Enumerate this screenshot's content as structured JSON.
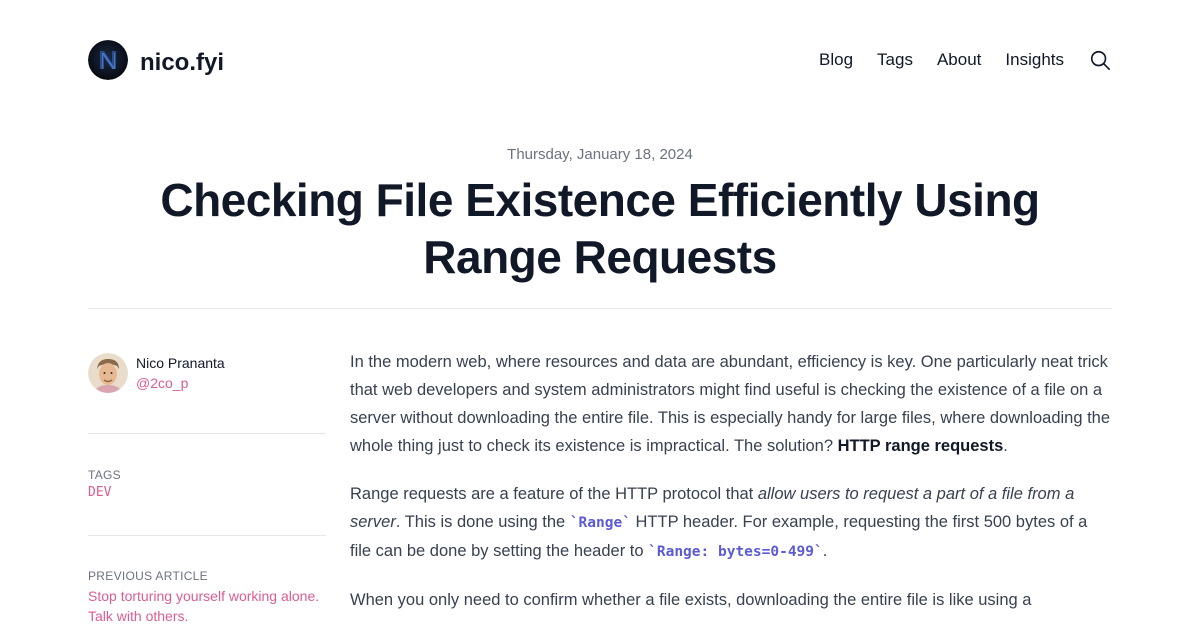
{
  "site": {
    "name": "nico.fyi"
  },
  "nav": {
    "items": [
      {
        "label": "Blog"
      },
      {
        "label": "Tags"
      },
      {
        "label": "About"
      },
      {
        "label": "Insights"
      }
    ]
  },
  "post": {
    "date": "Thursday, January 18, 2024",
    "title": "Checking File Existence Efficiently Using Range Requests"
  },
  "author": {
    "name": "Nico Prananta",
    "handle": "@2co_p"
  },
  "tags": {
    "label": "TAGS",
    "items": [
      "DEV"
    ]
  },
  "previous": {
    "label": "PREVIOUS ARTICLE",
    "title": "Stop torturing yourself working alone. Talk with others."
  },
  "body": {
    "p1_text": "In the modern web, where resources and data are abundant, efficiency is key. One particularly neat trick that web developers and system administrators might find useful is checking the existence of a file on a server without downloading the entire file. This is especially handy for large files, where downloading the whole thing just to check its existence is impractical. The solution? ",
    "p1_strong": "HTTP range requests",
    "p1_end": ".",
    "p2_a": "Range requests are a feature of the HTTP protocol that ",
    "p2_em": "allow users to request a part of a file from a server",
    "p2_b": ". This is done using the ",
    "p2_code1": "`Range`",
    "p2_c": " HTTP header. For example, requesting the first 500 bytes of a file can be done by setting the header to ",
    "p2_code2": "`Range: bytes=0-499`",
    "p2_d": ".",
    "p3": "When you only need to confirm whether a file exists, downloading the entire file is like using a"
  },
  "colors": {
    "accent": "#db5c93",
    "code": "#5b5bd6",
    "text": "#374151",
    "heading": "#111827"
  }
}
